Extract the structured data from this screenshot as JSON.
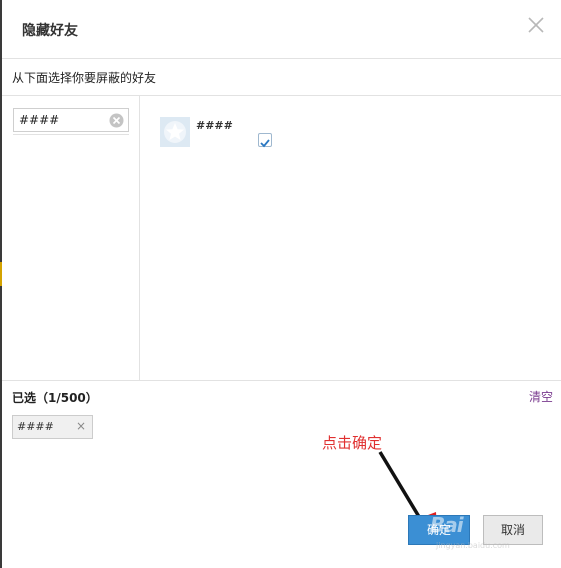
{
  "dialog": {
    "title": "隐藏好友",
    "subtitle": "从下面选择你要屏蔽的好友"
  },
  "search": {
    "value": "####",
    "placeholder": ""
  },
  "friends": [
    {
      "name": "####",
      "checked": true
    }
  ],
  "selected": {
    "label": "已选（1/500）",
    "clear_label": "清空",
    "chips": [
      {
        "name": "####",
        "remove": "×"
      }
    ]
  },
  "annotation": {
    "text": "点击确定"
  },
  "buttons": {
    "confirm_label": "确定",
    "cancel_label": "取消"
  },
  "watermark": {
    "text": "Bai",
    "sub": "jingyan.baidu.com"
  },
  "icons": {
    "close": "close-icon",
    "clear": "clear-icon",
    "avatar": "star-avatar-icon",
    "check": "check-icon",
    "arrow": "arrow-icon"
  },
  "colors": {
    "accent": "#3b8fd4",
    "link": "#7a3b8f",
    "annotation": "#e03030"
  }
}
